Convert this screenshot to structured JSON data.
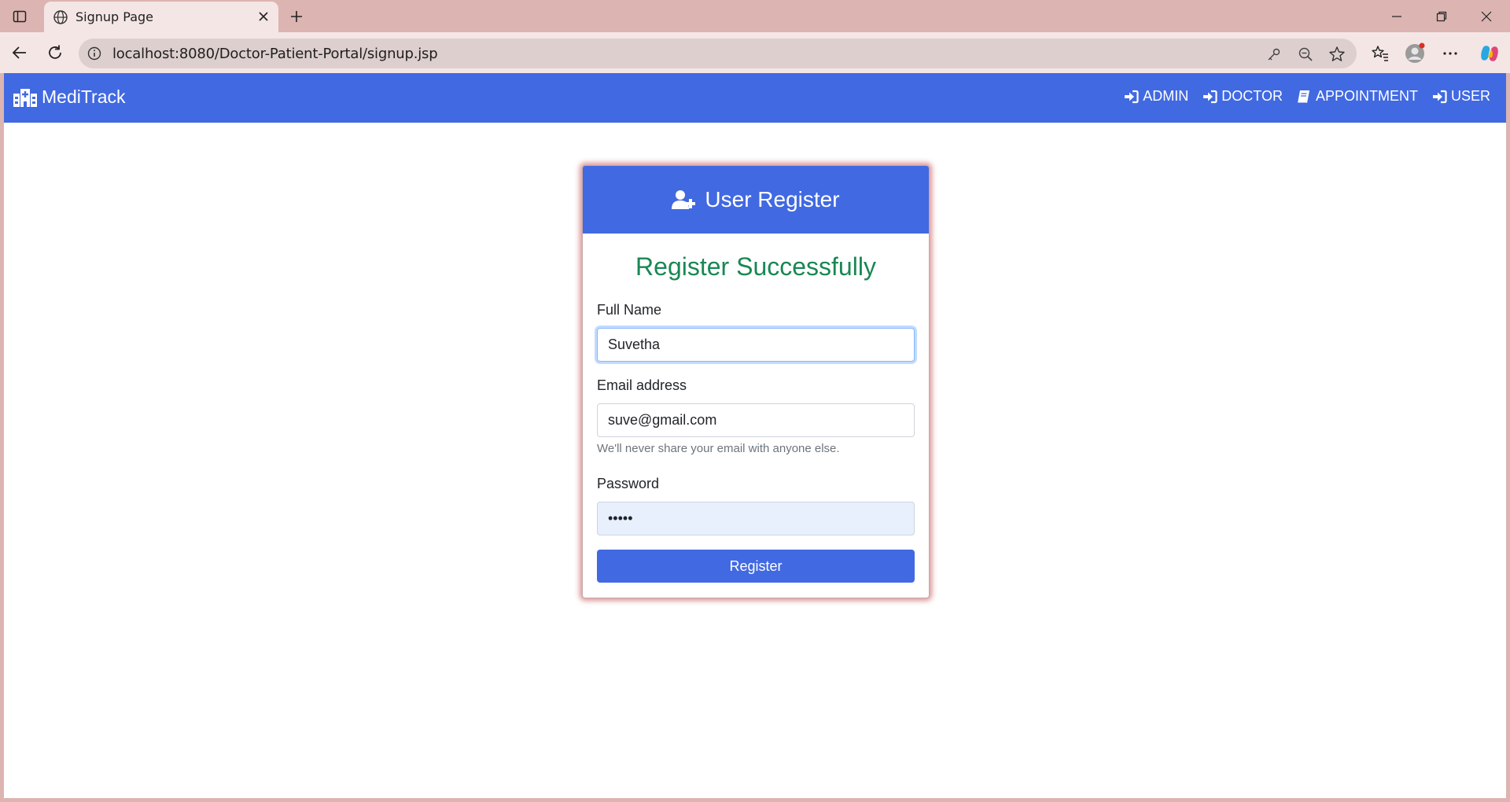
{
  "browser": {
    "tab": {
      "title": "Signup Page",
      "favicon": "globe-icon"
    },
    "url": "localhost:8080/Doctor-Patient-Portal/signup.jsp"
  },
  "site": {
    "brand": "MediTrack",
    "brand_icon": "hospital-icon",
    "nav": [
      {
        "label": "ADMIN",
        "icon": "sign-in-icon"
      },
      {
        "label": "DOCTOR",
        "icon": "sign-in-icon"
      },
      {
        "label": "APPOINTMENT",
        "icon": "book-icon"
      },
      {
        "label": "USER",
        "icon": "sign-in-icon"
      }
    ]
  },
  "card": {
    "title": "User Register",
    "title_icon": "user-plus-icon",
    "message": "Register Successfully",
    "fullname_label": "Full Name",
    "fullname_value": "Suvetha",
    "email_label": "Email address",
    "email_value": "suve@gmail.com",
    "email_help": "We'll never share your email with anyone else.",
    "password_label": "Password",
    "password_value": "•••••",
    "submit_label": "Register"
  },
  "colors": {
    "brand": "#4169e1",
    "success": "#198754",
    "browser_frame": "#dcb4b1"
  }
}
